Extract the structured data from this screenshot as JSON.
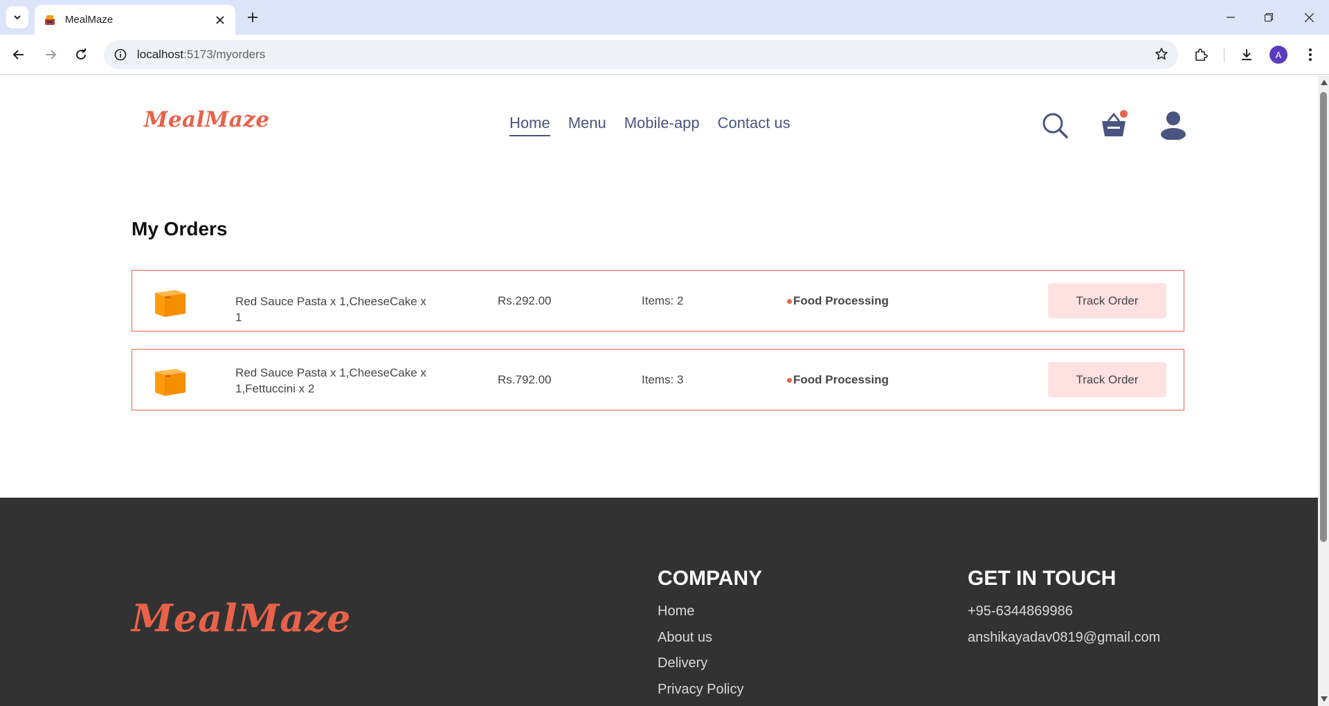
{
  "browser": {
    "tab_title": "MealMaze",
    "url_host": "localhost",
    "url_path": ":5173/myorders",
    "profile_initial": "A"
  },
  "site": {
    "logo": "MealMaze",
    "nav": [
      "Home",
      "Menu",
      "Mobile-app",
      "Contact us"
    ],
    "active_nav": "Home",
    "accent_color": "#e8624a"
  },
  "orders": {
    "title": "My Orders",
    "items": [
      {
        "items": "Red Sauce Pasta x 1,CheeseCake x 1",
        "amount": "Rs.292.00",
        "count": "Items: 2",
        "status": "Food Processing",
        "action": "Track Order"
      },
      {
        "items": "Red Sauce Pasta x 1,CheeseCake x 1,Fettuccini x 2",
        "amount": "Rs.792.00",
        "count": "Items: 3",
        "status": "Food Processing",
        "action": "Track Order"
      }
    ]
  },
  "footer": {
    "logo": "MealMaze",
    "company_heading": "COMPANY",
    "company_links": [
      "Home",
      "About us",
      "Delivery",
      "Privacy Policy"
    ],
    "contact_heading": "GET IN TOUCH",
    "contact": [
      "+95-6344869986",
      "anshikayadav0819@gmail.com"
    ]
  }
}
